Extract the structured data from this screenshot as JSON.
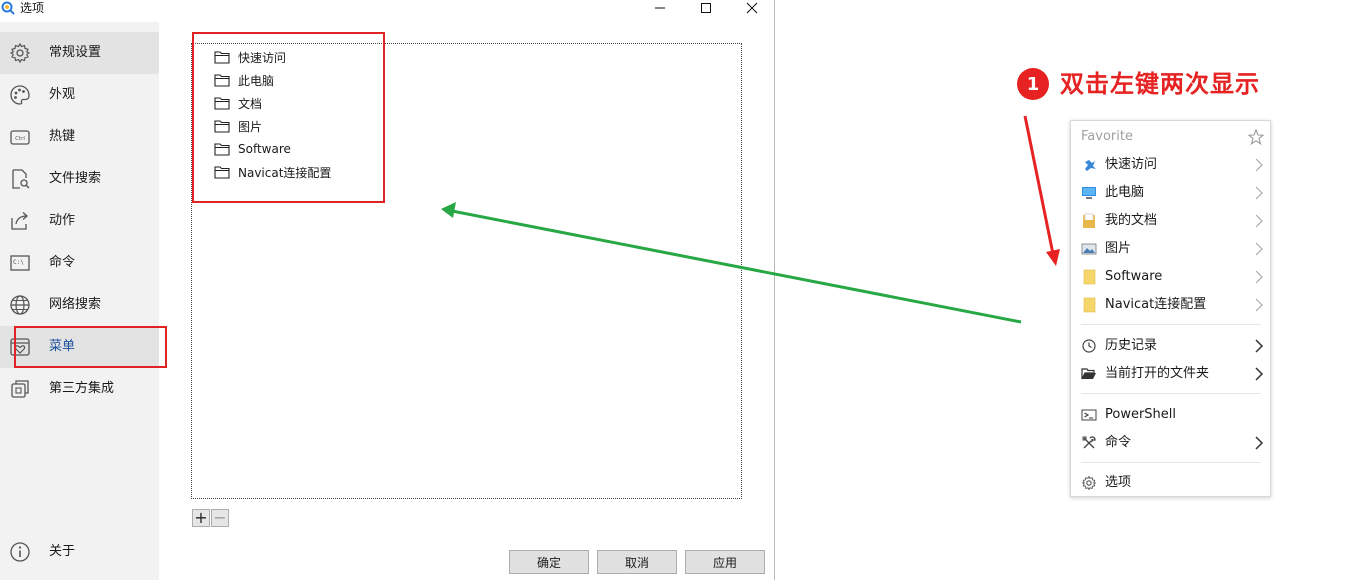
{
  "window": {
    "title": "选项",
    "controls": [
      "minimize-icon",
      "maximize-icon",
      "close-icon"
    ]
  },
  "sidebar": {
    "items": [
      {
        "label": "常规设置",
        "icon": "gear-icon"
      },
      {
        "label": "外观",
        "icon": "palette-icon"
      },
      {
        "label": "热键",
        "icon": "ctrl-key-icon"
      },
      {
        "label": "文件搜索",
        "icon": "file-search-icon"
      },
      {
        "label": "动作",
        "icon": "share-arrow-icon"
      },
      {
        "label": "命令",
        "icon": "terminal-icon"
      },
      {
        "label": "网络搜索",
        "icon": "globe-icon"
      },
      {
        "label": "菜单",
        "icon": "menu-heart-icon"
      },
      {
        "label": "第三方集成",
        "icon": "integration-icon"
      }
    ],
    "about": {
      "label": "关于",
      "icon": "info-icon"
    }
  },
  "favorites_list": {
    "items": [
      "快速访问",
      "此电脑",
      "文档",
      "图片",
      "Software",
      "Navicat连接配置"
    ]
  },
  "list_buttons": {
    "add": "+",
    "remove": "−"
  },
  "footer_buttons": {
    "ok": "确定",
    "cancel": "取消",
    "apply": "应用"
  },
  "annotation": {
    "number": "1",
    "text": "双击左键两次显示"
  },
  "popup_menu": {
    "header": "Favorite",
    "favorites": [
      {
        "label": "快速访问",
        "icon": "pin-icon"
      },
      {
        "label": "此电脑",
        "icon": "monitor-icon"
      },
      {
        "label": "我的文档",
        "icon": "documents-icon"
      },
      {
        "label": "图片",
        "icon": "pictures-icon"
      },
      {
        "label": "Software",
        "icon": "folder-icon"
      },
      {
        "label": "Navicat连接配置",
        "icon": "folder-icon"
      }
    ],
    "middle": [
      {
        "label": "历史记录",
        "icon": "clock-icon"
      },
      {
        "label": "当前打开的文件夹",
        "icon": "open-folder-icon"
      }
    ],
    "bottom": [
      {
        "label": "PowerShell",
        "icon": "powershell-icon"
      },
      {
        "label": "命令",
        "icon": "tools-icon"
      }
    ],
    "options": {
      "label": "选项",
      "icon": "gear-icon"
    }
  },
  "colors": {
    "annotation_red": "#e62222",
    "arrow_green": "#27a844",
    "selected_nav_text": "#1a4f9a",
    "folder_yellow": "#f5d66b"
  }
}
